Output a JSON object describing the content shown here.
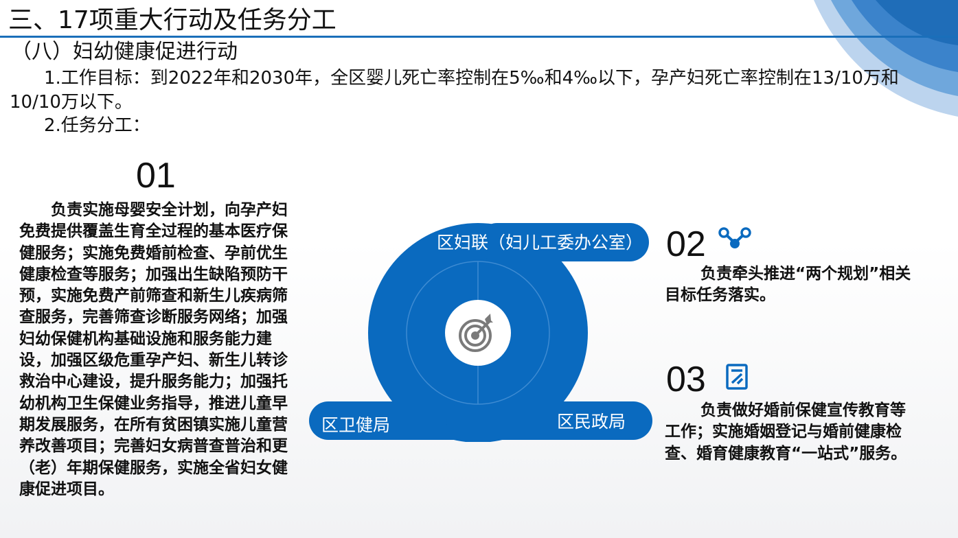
{
  "header": {
    "title": "三、17项重大行动及任务分工",
    "subtitle": "（八）妇幼健康促进行动"
  },
  "goal": {
    "text": "1.工作目标：到2022年和2030年，全区婴儿死亡率控制在5‰和4‰以下，孕产妇死亡率控制在13/10万和10/10万以下。"
  },
  "tasks_heading": "2.任务分工：",
  "colors": {
    "accent": "#0a6abf",
    "rule": "#1a6fba",
    "target_icon": "#7a7a7a"
  },
  "items": [
    {
      "number": "01",
      "text": "负责实施母婴安全计划，向孕产妇免费提供覆盖生育全过程的基本医疗保健服务；实施免费婚前检查、孕前优生健康检查等服务；加强出生缺陷预防干预，实施免费产前筛查和新生儿疾病筛查服务，完善筛查诊断服务网络；加强妇幼保健机构基础设施和服务能力建设，加强区级危重孕产妇、新生儿转诊救治中心建设，提升服务能力；加强托幼机构卫生保健业务指导，推进儿童早期发展服务，在所有贫困镇实施儿童营养改善项目；完善妇女病普查普治和更（老）年期保健服务，实施全省妇女健康促进项目。"
    },
    {
      "number": "02",
      "icon": "share-icon",
      "text": "负责牵头推进“两个规划”相关目标任务落实。"
    },
    {
      "number": "03",
      "icon": "document-icon",
      "text": "负责做好婚前保健宣传教育等工作；实施婚姻登记与婚前健康检查、婚育健康教育“一站式”服务。"
    }
  ],
  "diagram": {
    "center_icon": "target-icon",
    "labels": [
      "区妇联（妇儿工委办公室）",
      "区卫健局",
      "区民政局"
    ]
  }
}
